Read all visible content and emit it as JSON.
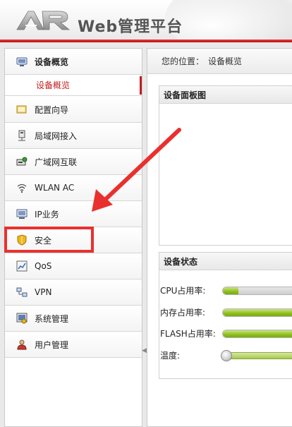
{
  "header": {
    "logo_text": "AR",
    "title": "Web管理平台",
    "accent_color": "#c21d1d"
  },
  "sidebar": {
    "items": [
      {
        "label": "设备概览",
        "icon": "device-overview-icon",
        "active": true
      },
      {
        "label": "配置向导",
        "icon": "wizard-icon"
      },
      {
        "label": "局域网接入",
        "icon": "lan-icon"
      },
      {
        "label": "广域网互联",
        "icon": "wan-icon"
      },
      {
        "label": "WLAN AC",
        "icon": "wifi-icon"
      },
      {
        "label": "IP业务",
        "icon": "ip-service-icon"
      },
      {
        "label": "安全",
        "icon": "shield-icon"
      },
      {
        "label": "QoS",
        "icon": "qos-icon"
      },
      {
        "label": "VPN",
        "icon": "vpn-icon"
      },
      {
        "label": "系统管理",
        "icon": "system-icon"
      },
      {
        "label": "用户管理",
        "icon": "user-icon"
      }
    ],
    "subitem": {
      "label": "设备概览"
    }
  },
  "main": {
    "breadcrumb_prefix": "您的位置：",
    "breadcrumb_current": "设备概览",
    "panel_board_title": "设备面板图",
    "panel_status_title": "设备状态",
    "stats": [
      {
        "label": "CPU占用率:",
        "level": 0.2
      },
      {
        "label": "内存占用率:",
        "level": 1.0
      },
      {
        "label": "FLASH占用率:",
        "level": 1.0
      }
    ],
    "temperature_label": "温度:"
  }
}
